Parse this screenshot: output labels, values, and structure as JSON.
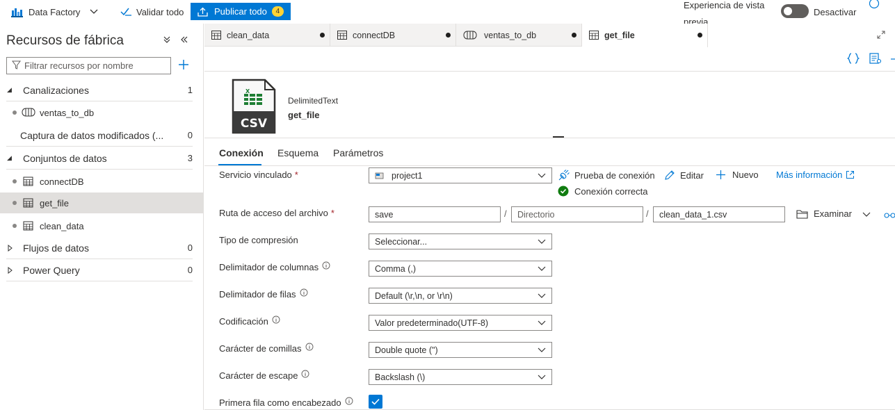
{
  "toolbar": {
    "app_name": "Data Factory",
    "validate_label": "Validar todo",
    "publish_label": "Publicar todo",
    "publish_count": "4",
    "preview_label_line1": "Experiencia de vista",
    "preview_label_line2": "previa",
    "toggle_label": "Desactivar"
  },
  "left_panel": {
    "title": "Recursos de fábrica",
    "filter_placeholder": "Filtrar recursos por nombre",
    "sections": [
      {
        "label": "Canalizaciones",
        "count": "1",
        "items": [
          "ventas_to_db"
        ]
      },
      {
        "label": "Captura de datos modificados (...",
        "count": "0",
        "items": []
      },
      {
        "label": "Conjuntos de datos",
        "count": "3",
        "items": [
          "connectDB",
          "get_file",
          "clean_data"
        ]
      },
      {
        "label": "Flujos de datos",
        "count": "0",
        "items": []
      },
      {
        "label": "Power Query",
        "count": "0",
        "items": []
      }
    ]
  },
  "tabs": [
    {
      "label": "clean_data",
      "icon": "table-icon"
    },
    {
      "label": "connectDB",
      "icon": "table-icon"
    },
    {
      "label": "ventas_to_db",
      "icon": "pipeline-icon"
    },
    {
      "label": "get_file",
      "icon": "table-icon"
    }
  ],
  "dataset": {
    "type": "DelimitedText",
    "name": "get_file",
    "icon_text": "CSV"
  },
  "subtabs": [
    "Conexión",
    "Esquema",
    "Parámetros"
  ],
  "form": {
    "linked_service": {
      "label": "Servicio vinculado",
      "required": "*",
      "value": "project1",
      "test_connection": "Prueba de conexión",
      "edit": "Editar",
      "new": "Nuevo",
      "more_info": "Más información",
      "status": "Conexión correcta"
    },
    "file_path": {
      "label": "Ruta de acceso del archivo",
      "required": "*",
      "container": "save",
      "directory_placeholder": "Directorio",
      "file": "clean_data_1.csv",
      "browse": "Examinar",
      "slash": "/"
    },
    "compression": {
      "label": "Tipo de compresión",
      "value": "Seleccionar..."
    },
    "column_delimiter": {
      "label": "Delimitador de columnas",
      "value": "Comma (,)"
    },
    "row_delimiter": {
      "label": "Delimitador de filas",
      "value": "Default (\\r,\\n, or \\r\\n)"
    },
    "encoding": {
      "label": "Codificación",
      "value": "Valor predeterminado(UTF-8)"
    },
    "quote_char": {
      "label": "Carácter de comillas",
      "value": "Double quote (\")"
    },
    "escape_char": {
      "label": "Carácter de escape",
      "value": "Backslash (\\)"
    },
    "first_row_header": {
      "label": "Primera fila como encabezado",
      "checked": true
    }
  },
  "colors": {
    "accent": "#0078d4",
    "badge": "#ffd335",
    "success": "#107c10",
    "required": "#a4262c"
  }
}
